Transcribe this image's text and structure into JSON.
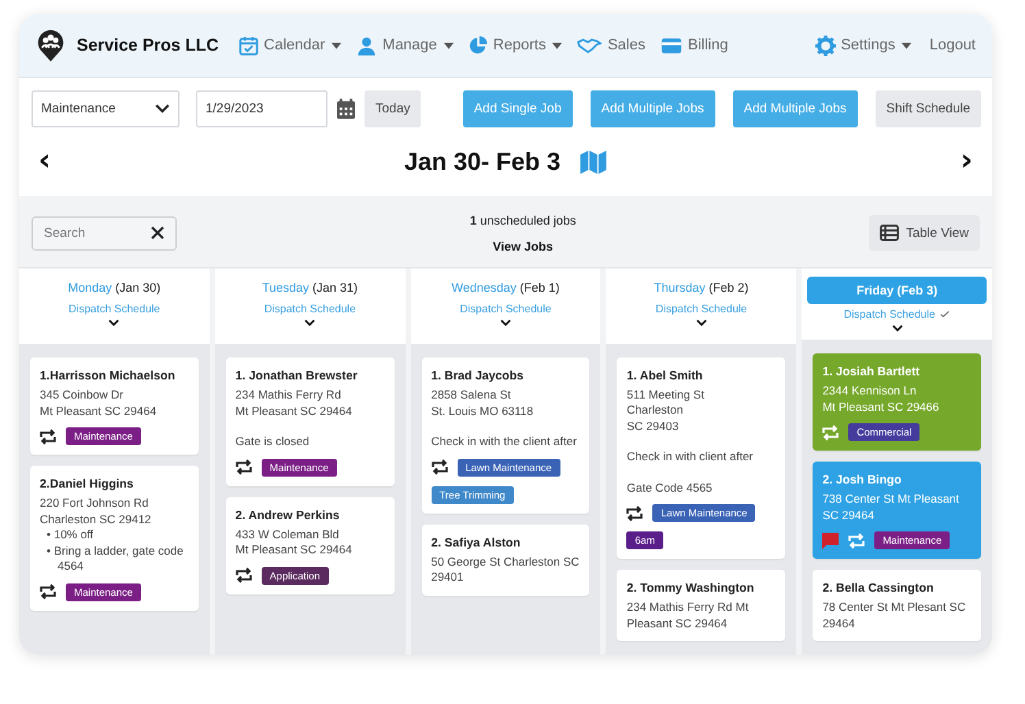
{
  "brand": {
    "name": "Service Pros LLC"
  },
  "nav": [
    {
      "label": "Calendar",
      "dropdown": true
    },
    {
      "label": "Manage",
      "dropdown": true
    },
    {
      "label": "Reports",
      "dropdown": true
    },
    {
      "label": "Sales",
      "dropdown": false
    },
    {
      "label": "Billing",
      "dropdown": false
    }
  ],
  "nav_right": [
    {
      "label": "Settings",
      "dropdown": true
    },
    {
      "label": "Logout",
      "dropdown": false
    }
  ],
  "toolbar": {
    "service_select": "Maintenance",
    "date_field": "1/29/2023",
    "today_button": "Today",
    "actions": [
      {
        "label": "Add Single Job",
        "kind": "primary"
      },
      {
        "label": "Add Multiple Jobs",
        "kind": "primary"
      },
      {
        "label": "Add Multiple Jobs",
        "kind": "primary"
      },
      {
        "label": "Shift Schedule",
        "kind": "secondary"
      }
    ]
  },
  "week": {
    "title": "Jan 30- Feb 3",
    "prev": "‹",
    "next": "›"
  },
  "search": {
    "placeholder": "Search"
  },
  "unscheduled": {
    "text": "**1** unscheduled jobs",
    "link": "View Jobs"
  },
  "table_view_button": "Table View",
  "days": [
    {
      "weekday": "Monday",
      "date": "(Jan 30)",
      "selected": false,
      "dispatch": "Dispatch Schedule",
      "dispatch_checked": false,
      "jobs": [
        {
          "title": "1.Harrisson Michaelson",
          "color": "#ffffff",
          "address": [
            "345 Coinbow Dr",
            "Mt Pleasant SC 29464"
          ],
          "flag": false,
          "recurring": true,
          "tags": [
            {
              "label": "Maintenance",
              "color": "#7b1f86"
            }
          ]
        },
        {
          "title": "2.Daniel Higgins",
          "color": "#ffffff",
          "address": [
            "220 Fort Johnson Rd",
            "Charleston SC 29412"
          ],
          "bullets": [
            "• 10% off",
            "• Bring a ladder, gate code 4564"
          ],
          "flag": false,
          "recurring": true,
          "tags": [
            {
              "label": "Maintenance",
              "color": "#7b1f86"
            }
          ]
        }
      ]
    },
    {
      "weekday": "Tuesday",
      "date": "(Jan 31)",
      "selected": false,
      "dispatch": "Dispatch Schedule",
      "dispatch_checked": false,
      "jobs": [
        {
          "title": "1. Jonathan Brewster",
          "color": "#ffffff",
          "address": [
            "234 Mathis Ferry Rd",
            "Mt Pleasant SC 29464"
          ],
          "notes": [
            "Gate is closed"
          ],
          "flag": false,
          "recurring": true,
          "tags": [
            {
              "label": "Maintenance",
              "color": "#7b1f86"
            }
          ]
        },
        {
          "title": "2. Andrew Perkins",
          "color": "#ffffff",
          "address": [
            "433 W Coleman Bld",
            "Mt Pleasant SC 29464"
          ],
          "flag": false,
          "recurring": true,
          "tags": [
            {
              "label": "Application",
              "color": "#5b2a5f"
            }
          ]
        }
      ]
    },
    {
      "weekday": "Wednesday",
      "date": "(Feb 1)",
      "selected": false,
      "dispatch": "Dispatch Schedule",
      "dispatch_checked": false,
      "jobs": [
        {
          "title": "1. Brad Jaycobs",
          "color": "#ffffff",
          "address": [
            "2858 Salena St",
            "St. Louis MO 63118"
          ],
          "notes": [
            "Check in with the client after"
          ],
          "flag": false,
          "recurring": true,
          "tags": [
            {
              "label": "Lawn Maintenance",
              "color": "#3a63b6"
            },
            {
              "label": "Tree Trimming",
              "color": "#3f88c9"
            }
          ]
        },
        {
          "title": "2. Safiya Alston",
          "color": "#ffffff",
          "address": [
            "50 George St Charleston SC 29401"
          ],
          "flag": false,
          "recurring": false
        }
      ]
    },
    {
      "weekday": "Thursday",
      "date": "(Feb 2)",
      "selected": false,
      "dispatch": "Dispatch Schedule",
      "dispatch_checked": false,
      "jobs": [
        {
          "title": "1. Abel Smith",
          "color": "#ffffff",
          "address": [
            "511 Meeting St",
            "Charleston",
            "SC 29403"
          ],
          "notes": [
            "Check in with client after",
            "Gate Code 4565"
          ],
          "flag": false,
          "recurring": true,
          "tags": [
            {
              "label": "Lawn Maintenance",
              "color": "#3a63b6"
            },
            {
              "label": "6am",
              "color": "#5a1e8a"
            }
          ]
        },
        {
          "title": "2. Tommy Washington",
          "color": "#ffffff",
          "address": [
            "234 Mathis Ferry Rd Mt Pleasant SC 29464"
          ],
          "flag": false,
          "recurring": false
        }
      ]
    },
    {
      "weekday": "Friday",
      "date": "(Feb 3)",
      "selected": true,
      "dispatch": "Dispatch Schedule",
      "dispatch_checked": true,
      "jobs": [
        {
          "title": "1. Josiah Bartlett",
          "color": "#76a82b",
          "address": [
            "2344 Kennison Ln",
            "Mt Pleasant SC 29466"
          ],
          "flag": false,
          "recurring": true,
          "tags": [
            {
              "label": "Commercial",
              "color": "#443b9c"
            }
          ]
        },
        {
          "title": "2. Josh Bingo",
          "color": "#2ea2e4",
          "address": [
            "738 Center St Mt Pleasant SC 29464"
          ],
          "flag": true,
          "recurring": true,
          "tags": [
            {
              "label": "Maintenance",
              "color": "#7b1f86"
            }
          ]
        },
        {
          "title": "2. Bella Cassington",
          "color": "#ffffff",
          "address": [
            "78 Center St Mt Plesant SC 29464"
          ],
          "flag": false,
          "recurring": false
        }
      ]
    }
  ]
}
